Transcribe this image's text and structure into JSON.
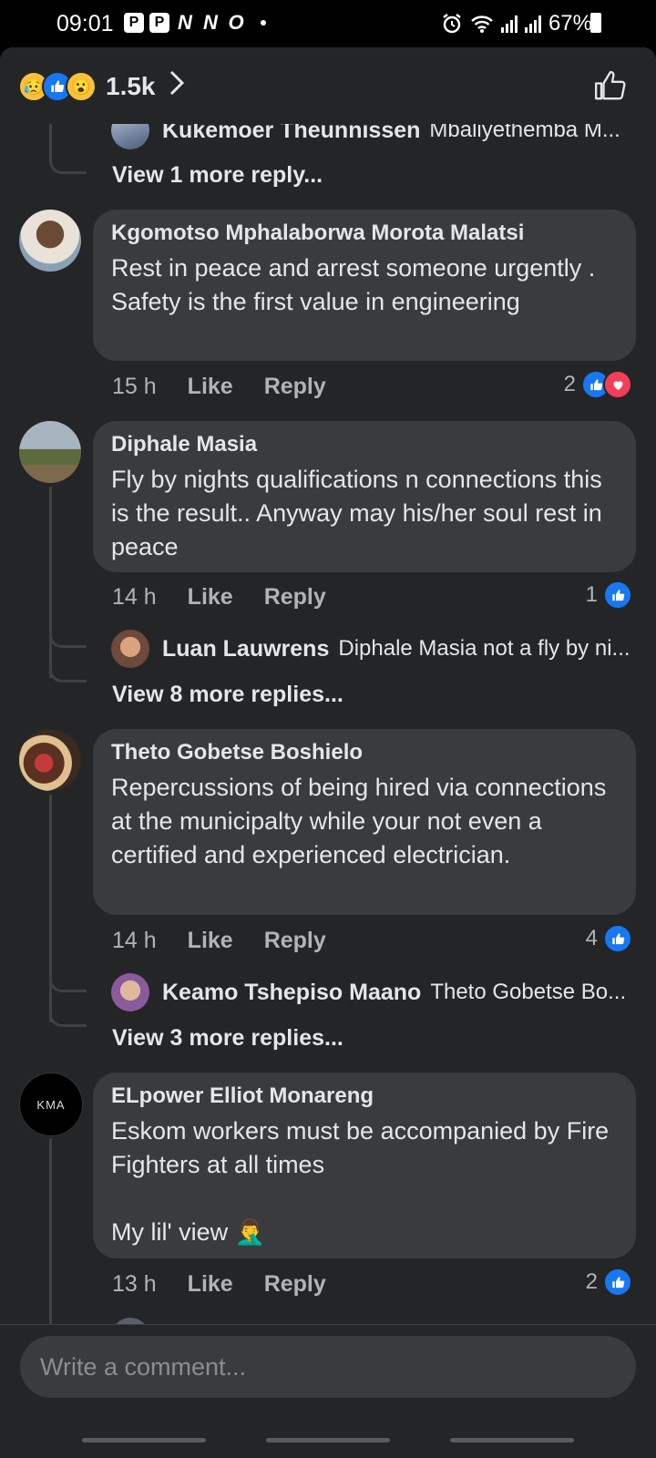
{
  "status_bar": {
    "time": "09:01",
    "app_icons": [
      "P",
      "P",
      "N",
      "N",
      "O"
    ],
    "battery": "67%"
  },
  "reactions_header": {
    "count": "1.5k",
    "reaction_icons": [
      "sad-icon",
      "like-icon",
      "wow-icon"
    ]
  },
  "comments": [
    {
      "replies_preview": {
        "name": "Kukemoer Theunnissen",
        "snippet": "Mbaliyethemba M..."
      },
      "view_more": "View 1 more reply..."
    },
    {
      "author": "Kgomotso Mphalaborwa Morota Malatsi",
      "text": "Rest in peace and arrest someone urgently . Safety is the first value in engineering",
      "time": "15 h",
      "like_label": "Like",
      "reply_label": "Reply",
      "reaction_count": "2"
    },
    {
      "author": "Diphale Masia",
      "text": "Fly by nights qualifications n connections this is the result.. Anyway may his/her soul rest in peace",
      "time": "14 h",
      "like_label": "Like",
      "reply_label": "Reply",
      "reaction_count": "1",
      "reply_preview": {
        "name": "Luan Lauwrens",
        "snippet": "Diphale Masia not a fly by ni..."
      },
      "view_more": "View 8 more replies..."
    },
    {
      "author": "Theto Gobetse Boshielo",
      "text": "Repercussions of being hired via connections at the municipalty while your not even a certified and experienced electrician.",
      "time": "14 h",
      "like_label": "Like",
      "reply_label": "Reply",
      "reaction_count": "4",
      "reply_preview": {
        "name": "Keamo Tshepiso Maano",
        "snippet": "Theto Gobetse Bo..."
      },
      "view_more": "View 3 more replies..."
    },
    {
      "author": "ELpower Elliot Monareng",
      "text": "Eskom workers must be accompanied by Fire Fighters at all times\n\nMy lil' view 🤦‍♂️",
      "avatar_text": "KMA",
      "time": "13 h",
      "like_label": "Like",
      "reply_label": "Reply",
      "reaction_count": "2"
    }
  ],
  "composer": {
    "placeholder": "Write a comment..."
  },
  "colors": {
    "background": "#242526",
    "bubble": "#3a3b3c",
    "like_blue": "#1877f2",
    "love_red": "#f33e58",
    "secondary_text": "#b0b3b8"
  }
}
